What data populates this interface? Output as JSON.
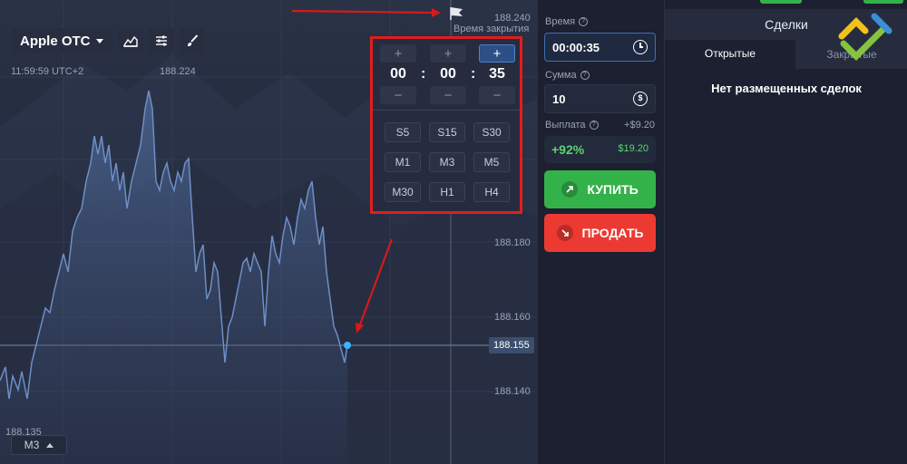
{
  "chart": {
    "asset": "Apple OTC",
    "time_label": "11:59:59 UTC+2",
    "price_top": "188.224",
    "expire_label": "Время закрытия",
    "axis_labels": [
      "188.240",
      "188.180",
      "188.160",
      "188.140"
    ],
    "current_price": "188.155",
    "low_label": "188.135",
    "timeframe": "M3",
    "colors": {
      "line": "#6d8fc6",
      "marker": "#3ab4ff",
      "arrow": "#d51a1a"
    }
  },
  "picker": {
    "plus": "+",
    "minus": "−",
    "hours": "00",
    "minutes": "00",
    "seconds": "35",
    "colon": ":",
    "presets": [
      "S5",
      "S15",
      "S30",
      "M1",
      "M3",
      "M5",
      "M30",
      "H1",
      "H4"
    ]
  },
  "panel": {
    "time_label": "Время",
    "time_value": "00:00:35",
    "amount_label": "Сумма",
    "amount_value": "10",
    "payout_label": "Выплата",
    "payout_plus": "+$9.20",
    "payout_pct": "+92%",
    "payout_amount": "$19.20",
    "buy_label": "КУПИТЬ",
    "sell_label": "ПРОДАТЬ",
    "colors": {
      "buy": "#34b24a",
      "sell": "#ec3a32"
    }
  },
  "deals": {
    "title": "Сделки",
    "tab_open": "Открытые",
    "tab_closed": "Закрытые",
    "empty": "Нет размещенных сделок"
  }
}
